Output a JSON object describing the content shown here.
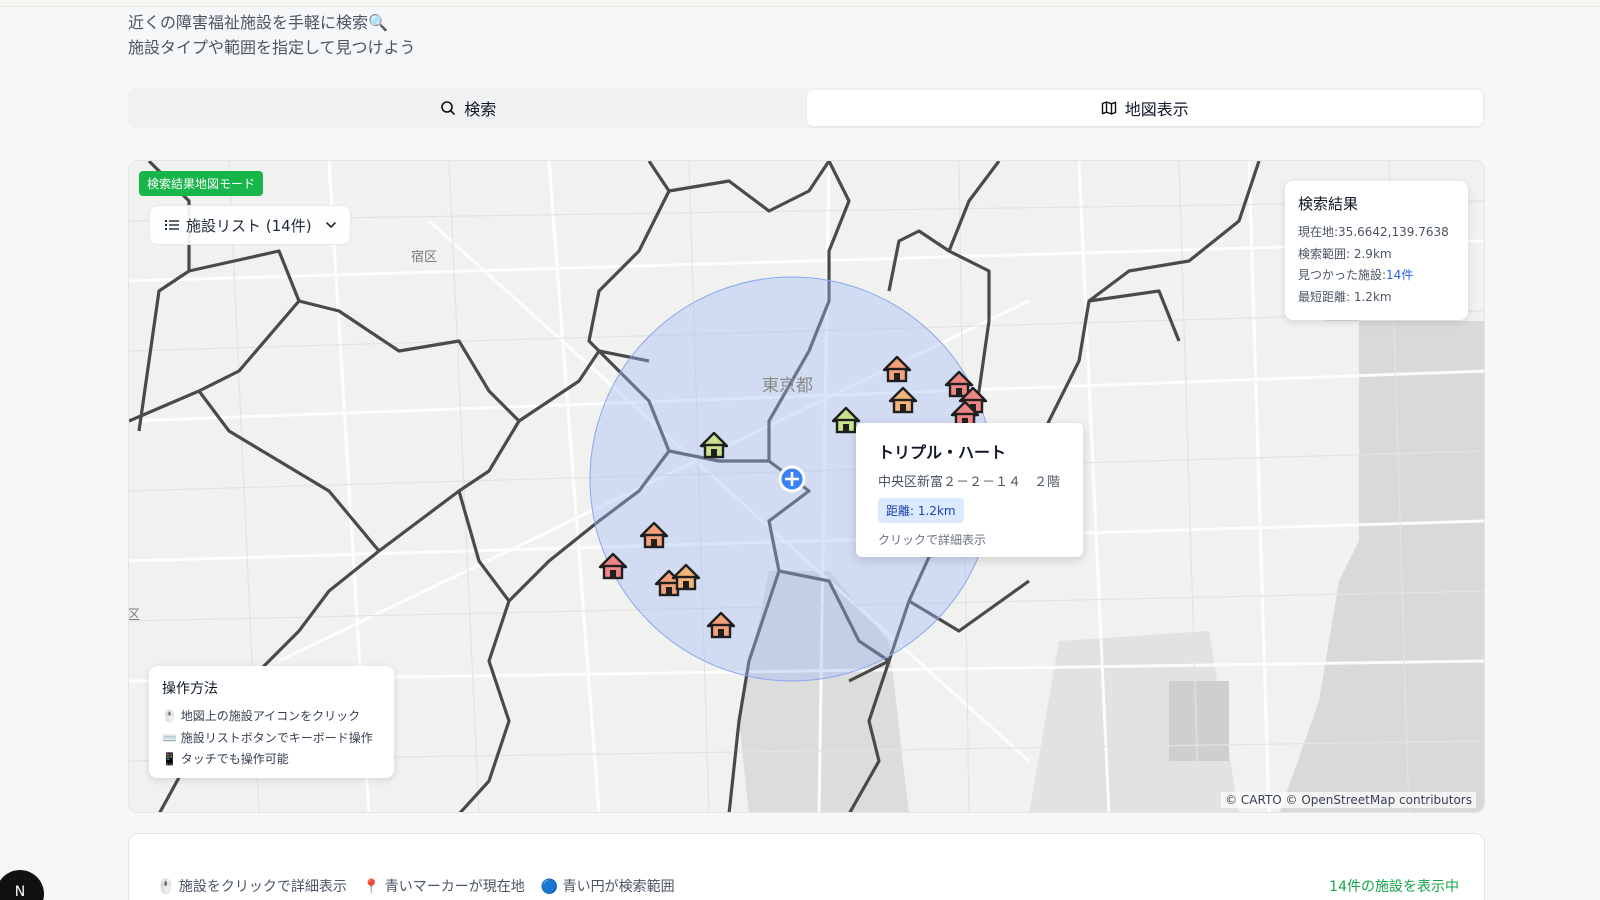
{
  "intro": {
    "line1": "近くの障害福祉施設を手軽に検索🔍",
    "line2": "施設タイプや範囲を指定して見つけよう"
  },
  "tabs": [
    {
      "label": "検索",
      "icon": "search-icon",
      "active": false
    },
    {
      "label": "地図表示",
      "icon": "map-icon",
      "active": true
    }
  ],
  "map": {
    "mode_badge": "検索結果地図モード",
    "facility_list_button": "施設リスト (14件)",
    "labels": {
      "district_shuku": "宿区",
      "tokyo": "東京都",
      "edge_ku": "区"
    },
    "results_panel": {
      "title": "検索結果",
      "current_location": "現在地:35.6642,139.7638",
      "search_range": "検索範囲: 2.9km",
      "found_prefix": "見つかった施設:",
      "found_count": "14件",
      "nearest": "最短距離: 1.2km"
    },
    "popup": {
      "name": "トリプル・ハート",
      "address": "中央区新富２－２－１４　２階",
      "distance": "距離: 1.2km",
      "hint": "クリックで詳細表示"
    },
    "howto": {
      "title": "操作方法",
      "items": [
        "🖱️ 地図上の施設アイコンをクリック",
        "⌨️ 施設リストボタンでキーボード操作",
        "📱 タッチでも操作可能"
      ]
    },
    "attribution": "© CARTO © OpenStreetMap contributors",
    "colors": {
      "search_circle": "#9db7f5",
      "location_marker": "#3b82f6",
      "badge": "#17b54a"
    }
  },
  "footer": {
    "legend": [
      "🖱️ 施設をクリックで詳細表示",
      "📍 青いマーカーが現在地",
      "🔵 青い円が検索範囲"
    ],
    "count": "14件の施設を表示中"
  },
  "avatar": "N"
}
